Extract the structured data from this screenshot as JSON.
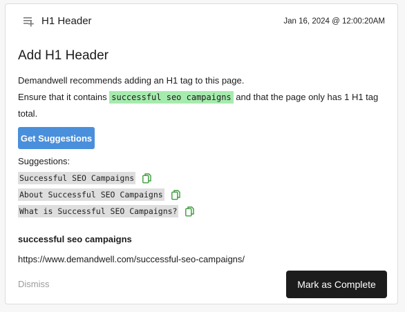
{
  "header": {
    "title": "H1 Header",
    "date": "Jan 16, 2024 @ 12:00:20AM",
    "icon": "add-list-icon"
  },
  "task": {
    "title": "Add H1 Header",
    "line1": "Demandwell recommends adding an H1 tag to this page.",
    "line2_prefix": "Ensure that it contains ",
    "keyword": "successful seo campaigns",
    "line2_suffix": " and that the page only has 1 H1 tag total."
  },
  "buttons": {
    "get_suggestions": "Get Suggestions",
    "mark_complete": "Mark as Complete",
    "dismiss": "Dismiss"
  },
  "suggestions": {
    "label": "Suggestions:",
    "items": [
      "Successful SEO Campaigns",
      "About Successful SEO Campaigns",
      "What is Successful SEO Campaigns?"
    ],
    "copy_icon": "copy-icon"
  },
  "footer_info": {
    "keyword": "successful seo campaigns",
    "url": "https://www.demandwell.com/successful-seo-campaigns/"
  },
  "colors": {
    "primary_button": "#4a8fdb",
    "complete_button": "#1c1c1c",
    "keyword_highlight": "#a6ebae",
    "suggestion_bg": "#dedede",
    "copy_icon": "#3a9b3a"
  }
}
